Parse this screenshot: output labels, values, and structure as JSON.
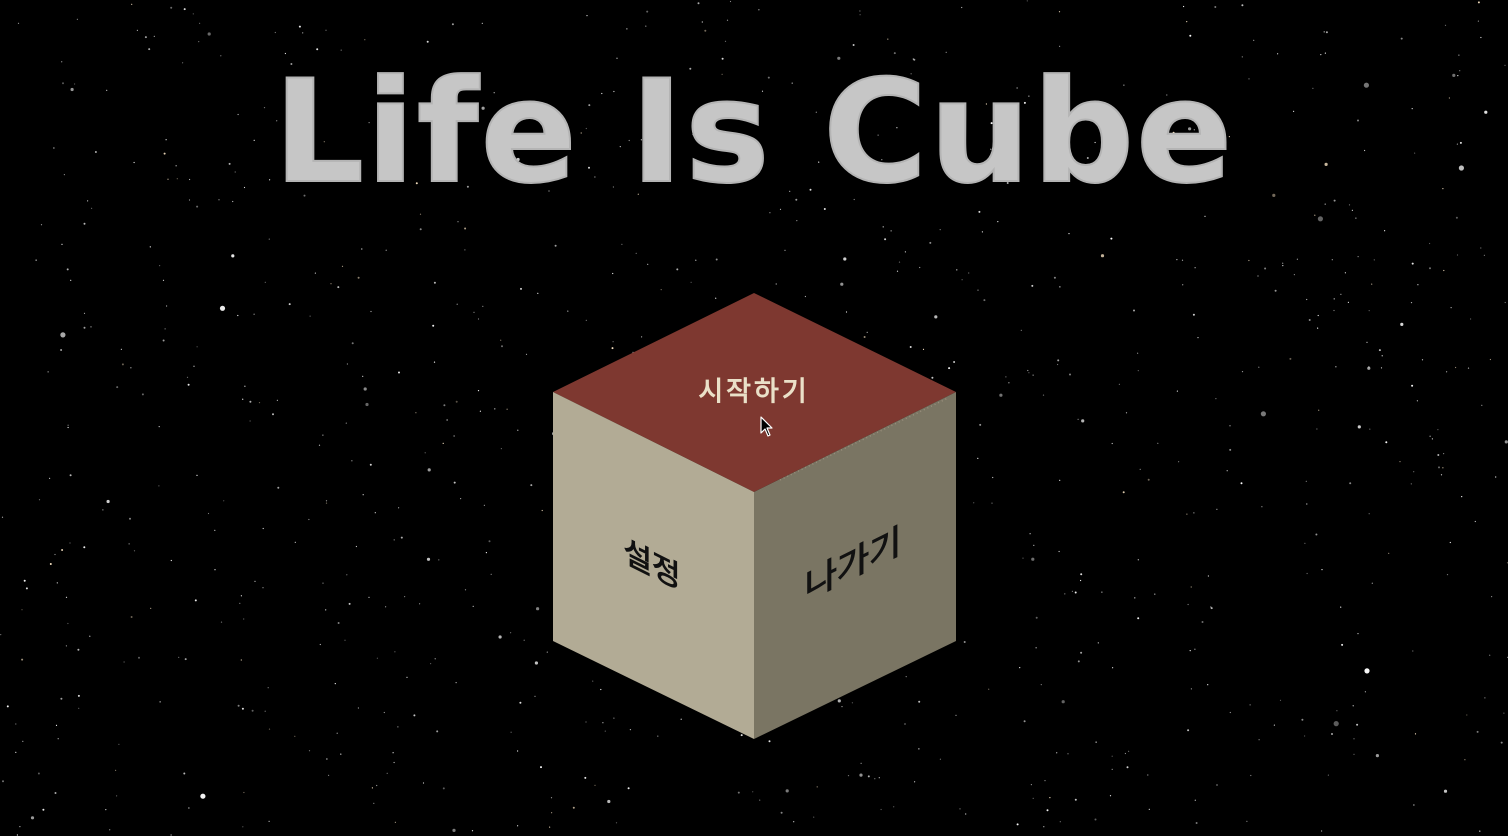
{
  "game": {
    "title": "Life Is Cube",
    "menu": {
      "start_label": "시작하기",
      "settings_label": "설정",
      "exit_label": "나가기"
    }
  },
  "colors": {
    "background": "#000000",
    "title": "#c6c6c6",
    "cube_top": "#7e3830",
    "cube_left": "#b2ab95",
    "cube_right": "#7a7563",
    "start_text": "#eae0c8",
    "side_text": "#111111"
  },
  "icons": {
    "pointer": "mouse-pointer-icon"
  }
}
